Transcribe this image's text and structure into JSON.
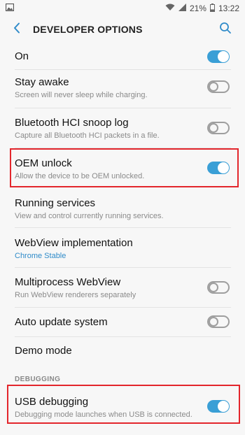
{
  "status_bar": {
    "left_icon": "image-icon",
    "battery_percent": "21%",
    "time": "13:22"
  },
  "app_bar": {
    "title": "DEVELOPER OPTIONS",
    "back_icon": "chevron-left-icon",
    "search_icon": "search-icon"
  },
  "master_switch": {
    "label": "On",
    "enabled": true
  },
  "settings": [
    {
      "title": "Stay awake",
      "subtitle": "Screen will never sleep while charging.",
      "toggle": false
    },
    {
      "title": "Bluetooth HCI snoop log",
      "subtitle": "Capture all Bluetooth HCI packets in a file.",
      "toggle": false
    },
    {
      "title": "OEM unlock",
      "subtitle": "Allow the device to be OEM unlocked.",
      "toggle": true
    },
    {
      "title": "Running services",
      "subtitle": "View and control currently running services."
    },
    {
      "title": "WebView implementation",
      "subtitle": "Chrome Stable"
    },
    {
      "title": "Multiprocess WebView",
      "subtitle": "Run WebView renderers separately",
      "toggle": false
    },
    {
      "title": "Auto update system",
      "toggle": false
    },
    {
      "title": "Demo mode"
    }
  ],
  "debugging_section": {
    "header": "DEBUGGING",
    "items": [
      {
        "title": "USB debugging",
        "subtitle": "Debugging mode launches when USB is connected.",
        "toggle": true
      }
    ]
  },
  "colors": {
    "accent": "#3a9fd6",
    "link": "#2f8bc9",
    "highlight": "#e3262c"
  }
}
